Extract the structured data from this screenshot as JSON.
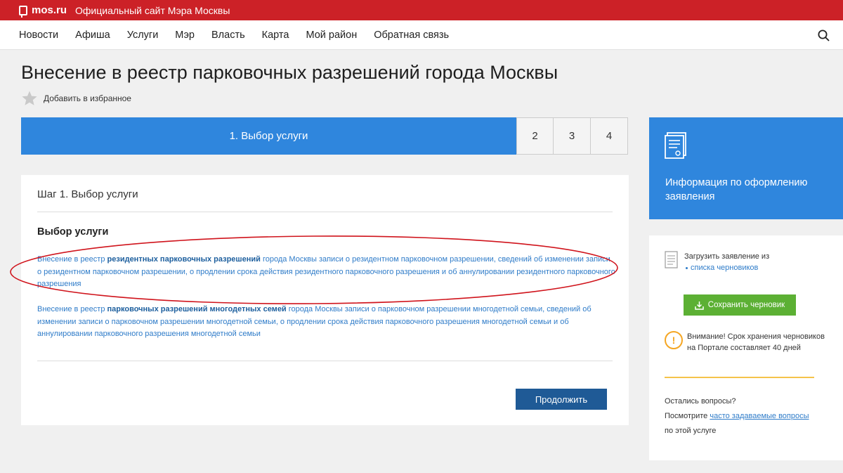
{
  "topbar": {
    "brand": "mos.ru",
    "slogan": "Официальный сайт Мэра Москвы"
  },
  "nav": {
    "items": [
      "Новости",
      "Афиша",
      "Услуги",
      "Мэр",
      "Власть",
      "Карта",
      "Мой район",
      "Обратная связь"
    ]
  },
  "page": {
    "title": "Внесение в реестр парковочных разрешений города Москвы",
    "favorite_label": "Добавить в избранное"
  },
  "steps": {
    "active": "1. Выбор услуги",
    "others": [
      "2",
      "3",
      "4"
    ]
  },
  "card": {
    "step_heading": "Шаг 1. Выбор услуги",
    "section_title": "Выбор услуги",
    "option1": {
      "prefix": "Внесение в реестр ",
      "bold": "резидентных парковочных разрешений",
      "suffix": " города Москвы записи о резидентном парковочном разрешении, сведений об изменении записи о резидентном парковочном разрешении, о продлении срока действия резидентного парковочного разрешения и об аннулировании резидентного парковочного разрешения"
    },
    "option2": {
      "prefix": "Внесение в реестр ",
      "bold": "парковочных разрешений многодетных семей",
      "suffix": " города Москвы записи о парковочном разрешении многодетной семьи, сведений об изменении записи о парковочном разрешении многодетной семьи, о продлении срока действия парковочного разрешения многодетной семьи и об аннулировании парковочного разрешения многодетной семьи"
    },
    "continue_label": "Продолжить"
  },
  "sidebar": {
    "info_label": "Информация по оформлению заявления",
    "load_label": "Загрузить заявление из",
    "drafts_link": "списка черновиков",
    "save_label": "Сохранить черновик",
    "warning": "Внимание! Срок хранения черновиков на Портале составляет 40 дней",
    "questions": "Остались вопросы?",
    "see_prefix": "Посмотрите ",
    "faq_link": "часто задаваемые вопросы",
    "see_suffix": "по этой услуге"
  },
  "colors": {
    "brand_red": "#cc2127",
    "accent_blue": "#2f86dd",
    "button_dark_blue": "#1f5a96",
    "save_green": "#5cb034",
    "warning_orange": "#f5a623",
    "annotation_red": "#d0141c"
  }
}
